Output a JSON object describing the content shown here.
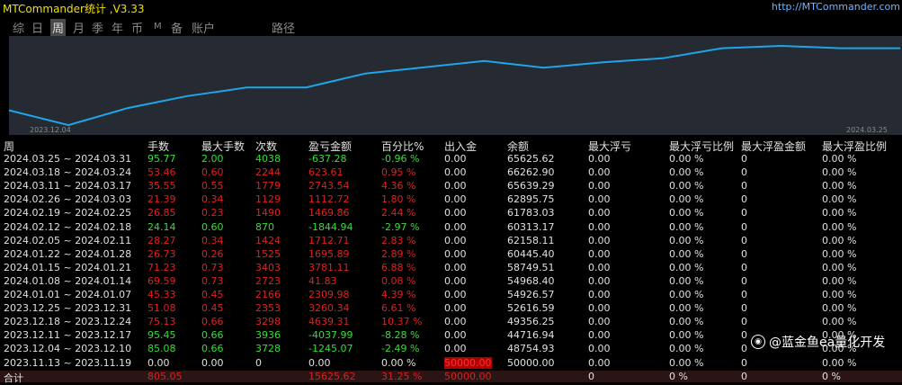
{
  "app": {
    "title": "MTCommander统计 ,V3.33",
    "url": "http://MTCommander.com"
  },
  "tabs": [
    {
      "label": "综",
      "active": false
    },
    {
      "label": "日",
      "active": false
    },
    {
      "label": "周",
      "active": true
    },
    {
      "label": "月",
      "active": false
    },
    {
      "label": "季",
      "active": false
    },
    {
      "label": "年",
      "active": false
    },
    {
      "label": "币",
      "active": false
    },
    {
      "label": "M",
      "active": false
    },
    {
      "label": "备",
      "active": false
    },
    {
      "label": "账户",
      "active": false
    },
    {
      "label": "路径",
      "active": false
    }
  ],
  "chart_data": {
    "type": "line",
    "x_start_label": "2023.12.04",
    "x_end_label": "2024.03.25",
    "x": [
      "2023.12.04",
      "2023.12.11",
      "2023.12.18",
      "2023.12.25",
      "2024.01.01",
      "2024.01.08",
      "2024.01.15",
      "2024.01.22",
      "2024.02.05",
      "2024.02.12",
      "2024.02.19",
      "2024.02.26",
      "2024.03.04",
      "2024.03.11",
      "2024.03.18",
      "2024.03.25"
    ],
    "y": [
      48754.93,
      44716.94,
      49356.25,
      52616.59,
      54926.57,
      54968.4,
      58749.51,
      60445.4,
      62158.11,
      60313.17,
      61783.03,
      62895.75,
      65639.29,
      66262.9,
      65625.62,
      65625.62
    ],
    "line_color": "#1ea6e8"
  },
  "table": {
    "headers": [
      "周",
      "手数",
      "最大手数",
      "次数",
      "盈亏金额",
      "百分比%",
      "出入金",
      "余额",
      "最大浮亏",
      "最大浮亏比例",
      "最大浮盈金额",
      "最大浮盈比例"
    ],
    "rows": [
      {
        "color": "green",
        "cells": [
          "2024.03.25 ~ 2024.03.31",
          "95.77",
          "2.00",
          "4038",
          "-637.28",
          "-0.96 %",
          "0.00",
          "65625.62",
          "0.00",
          "0.00 %",
          "0",
          "0.00 %"
        ]
      },
      {
        "color": "red",
        "cells": [
          "2024.03.18 ~ 2024.03.24",
          "53.46",
          "0.60",
          "2244",
          "623.61",
          "0.95 %",
          "0.00",
          "66262.90",
          "0.00",
          "0.00 %",
          "0",
          "0.00 %"
        ]
      },
      {
        "color": "red",
        "cells": [
          "2024.03.11 ~ 2024.03.17",
          "35.55",
          "0.55",
          "1779",
          "2743.54",
          "4.36 %",
          "0.00",
          "65639.29",
          "0.00",
          "0.00 %",
          "0",
          "0.00 %"
        ]
      },
      {
        "color": "red",
        "cells": [
          "2024.02.26 ~ 2024.03.03",
          "21.39",
          "0.34",
          "1129",
          "1112.72",
          "1.80 %",
          "0.00",
          "62895.75",
          "0.00",
          "0.00 %",
          "0",
          "0.00 %"
        ]
      },
      {
        "color": "red",
        "cells": [
          "2024.02.19 ~ 2024.02.25",
          "26.85",
          "0.23",
          "1490",
          "1469.86",
          "2.44 %",
          "0.00",
          "61783.03",
          "0.00",
          "0.00 %",
          "0",
          "0.00 %"
        ]
      },
      {
        "color": "green",
        "cells": [
          "2024.02.12 ~ 2024.02.18",
          "24.14",
          "0.60",
          "870",
          "-1844.94",
          "-2.97 %",
          "0.00",
          "60313.17",
          "0.00",
          "0.00 %",
          "0",
          "0.00 %"
        ]
      },
      {
        "color": "red",
        "cells": [
          "2024.02.05 ~ 2024.02.11",
          "28.27",
          "0.34",
          "1424",
          "1712.71",
          "2.83 %",
          "0.00",
          "62158.11",
          "0.00",
          "0.00 %",
          "0",
          "0.00 %"
        ]
      },
      {
        "color": "red",
        "cells": [
          "2024.01.22 ~ 2024.01.28",
          "26.73",
          "0.26",
          "1525",
          "1695.89",
          "2.89 %",
          "0.00",
          "60445.40",
          "0.00",
          "0.00 %",
          "0",
          "0.00 %"
        ]
      },
      {
        "color": "red",
        "cells": [
          "2024.01.15 ~ 2024.01.21",
          "71.23",
          "0.73",
          "3403",
          "3781.11",
          "6.88 %",
          "0.00",
          "58749.51",
          "0.00",
          "0.00 %",
          "0",
          "0.00 %"
        ]
      },
      {
        "color": "red",
        "cells": [
          "2024.01.08 ~ 2024.01.14",
          "69.59",
          "0.73",
          "2723",
          "41.83",
          "0.08 %",
          "0.00",
          "54968.40",
          "0.00",
          "0.00 %",
          "0",
          "0.00 %"
        ]
      },
      {
        "color": "red",
        "cells": [
          "2024.01.01 ~ 2024.01.07",
          "45.33",
          "0.45",
          "2166",
          "2309.98",
          "4.39 %",
          "0.00",
          "54926.57",
          "0.00",
          "0.00 %",
          "0",
          "0.00 %"
        ]
      },
      {
        "color": "red",
        "cells": [
          "2023.12.25 ~ 2023.12.31",
          "51.08",
          "0.45",
          "2353",
          "3260.34",
          "6.61 %",
          "0.00",
          "52616.59",
          "0.00",
          "0.00 %",
          "0",
          "0.00 %"
        ]
      },
      {
        "color": "red",
        "cells": [
          "2023.12.18 ~ 2023.12.24",
          "75.13",
          "0.66",
          "3298",
          "4639.31",
          "10.37 %",
          "0.00",
          "49356.25",
          "0.00",
          "0.00 %",
          "0",
          "0.00 %"
        ]
      },
      {
        "color": "green",
        "cells": [
          "2023.12.11 ~ 2023.12.17",
          "95.45",
          "0.66",
          "3936",
          "-4037.99",
          "-8.28 %",
          "0.00",
          "44716.94",
          "0.00",
          "0.00 %",
          "0",
          "0.00 %"
        ]
      },
      {
        "color": "green",
        "cells": [
          "2023.12.04 ~ 2023.12.10",
          "85.08",
          "0.66",
          "3728",
          "-1245.07",
          "-2.49 %",
          "0.00",
          "48754.93",
          "0.00",
          "0.00 %",
          "0",
          "0.00 %"
        ]
      },
      {
        "color": "white",
        "deposit": true,
        "cells": [
          "2023.11.13 ~ 2023.11.19",
          "0.00",
          "0.00",
          "0",
          "0.00",
          "0.00 %",
          "50000.00",
          "50000.00",
          "0.00",
          "0.00 %",
          "0",
          "0.00 %"
        ]
      }
    ],
    "total": {
      "cells": [
        "合计",
        "805.05",
        "",
        "",
        "15625.62",
        "31.25 %",
        "50000.00",
        "",
        "0",
        "0 %",
        "0",
        "0 %"
      ]
    }
  },
  "watermark": {
    "text": "@蓝金鱼ea量化开发",
    "icon": "camera-icon"
  }
}
